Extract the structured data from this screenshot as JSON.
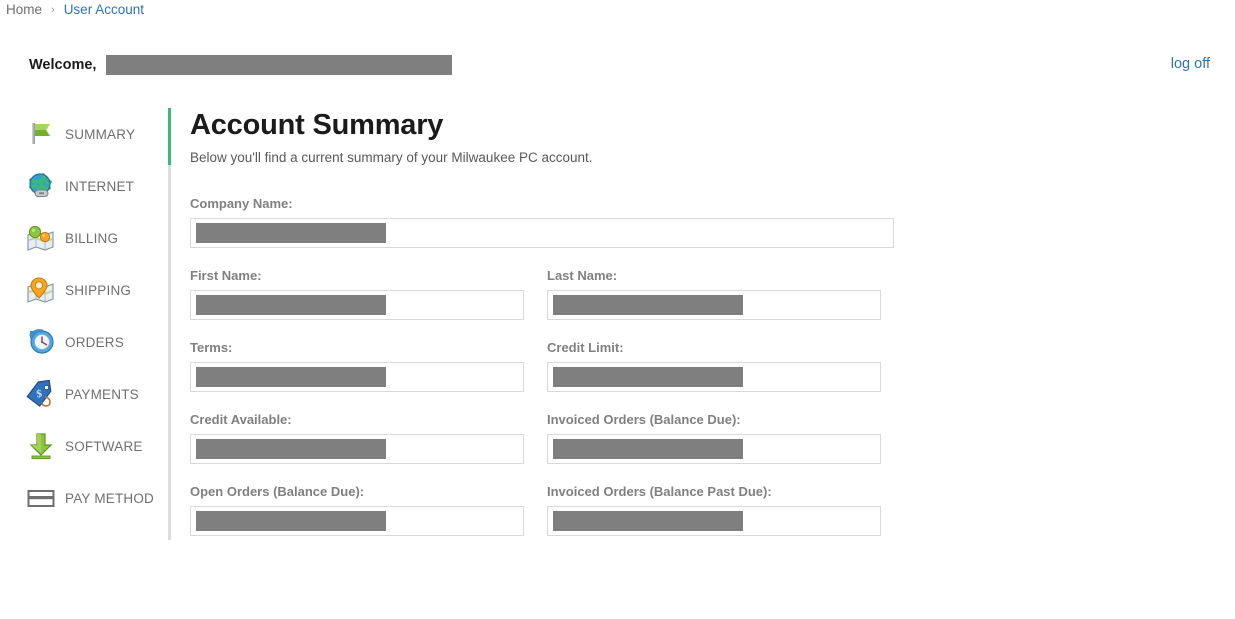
{
  "breadcrumb": {
    "home_label": "Home",
    "separator": "›",
    "current_label": "User Account"
  },
  "header": {
    "welcome_label": "Welcome,",
    "welcome_value_redacted": true,
    "logoff_label": "log off"
  },
  "sidebar": {
    "items": [
      {
        "label": "SUMMARY",
        "icon": "flag-icon"
      },
      {
        "label": "INTERNET",
        "icon": "globe-link-icon"
      },
      {
        "label": "BILLING",
        "icon": "map-billing-icon"
      },
      {
        "label": "SHIPPING",
        "icon": "map-pin-shipping-icon"
      },
      {
        "label": "ORDERS",
        "icon": "clock-history-icon"
      },
      {
        "label": "PAYMENTS",
        "icon": "price-tag-dollar-icon"
      },
      {
        "label": "SOFTWARE",
        "icon": "download-arrow-icon"
      },
      {
        "label": "PAY METHOD",
        "icon": "credit-card-icon"
      }
    ]
  },
  "main": {
    "title": "Account Summary",
    "subtitle": "Below you'll find a current summary of your Milwaukee PC account.",
    "fields": [
      {
        "label": "Company Name:",
        "value": "",
        "redacted": true
      },
      {
        "label": "First Name:",
        "value": "",
        "redacted": true
      },
      {
        "label": "Last Name:",
        "value": "",
        "redacted": true
      },
      {
        "label": "Terms:",
        "value": "",
        "redacted": true
      },
      {
        "label": "Credit Limit:",
        "value": "",
        "redacted": true
      },
      {
        "label": "Credit Available:",
        "value": "",
        "redacted": true
      },
      {
        "label": "Invoiced Orders (Balance Due):",
        "value": "",
        "redacted": true
      },
      {
        "label": "Open Orders (Balance Due):",
        "value": "",
        "redacted": true
      },
      {
        "label": "Invoiced Orders (Balance Past Due):",
        "value": "",
        "redacted": true
      }
    ]
  },
  "colors": {
    "link": "#2e74b5",
    "accent_green": "#3cb878",
    "redaction": "#7f7f7f",
    "label_gray": "#808080",
    "divider": "#dcdcdc"
  }
}
